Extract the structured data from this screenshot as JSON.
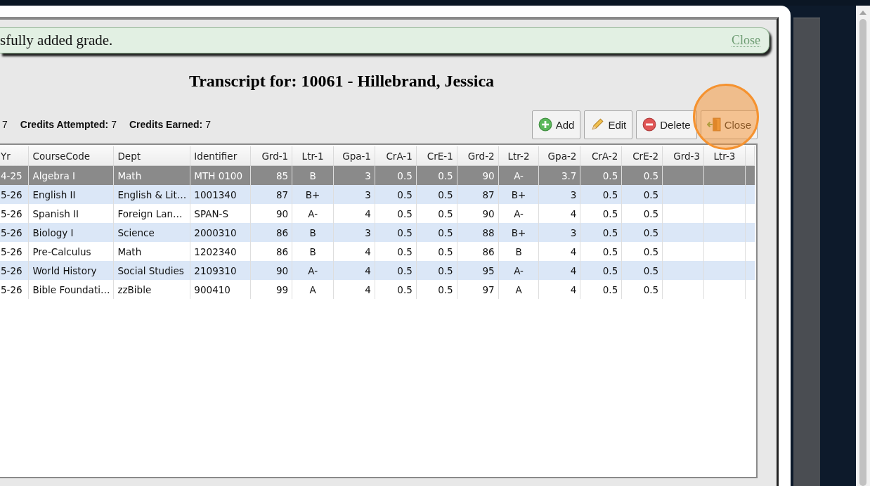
{
  "message": {
    "text": "sfully added grade.",
    "close_label": "Close"
  },
  "title": "Transcript for: 10061 - Hillebrand, Jessica",
  "stats": [
    {
      "value": "7"
    },
    {
      "label": "Credits Attempted:",
      "value": "7"
    },
    {
      "label": "Credits Earned:",
      "value": "7"
    }
  ],
  "buttons": [
    {
      "label": "Add",
      "kind": "add",
      "highlighted": false
    },
    {
      "label": "Edit",
      "kind": "edit",
      "highlighted": false
    },
    {
      "label": "Delete",
      "kind": "delete",
      "highlighted": false
    },
    {
      "label": "Close",
      "kind": "close",
      "highlighted": true
    }
  ],
  "table": {
    "columns": [
      {
        "label": "Yr",
        "kind": "text"
      },
      {
        "label": "CourseCode",
        "kind": "text"
      },
      {
        "label": "Dept",
        "kind": "text"
      },
      {
        "label": "Identifier",
        "kind": "text"
      },
      {
        "label": "Grd-1",
        "kind": "number"
      },
      {
        "label": "Ltr-1",
        "kind": "letter"
      },
      {
        "label": "Gpa-1",
        "kind": "number"
      },
      {
        "label": "CrA-1",
        "kind": "number"
      },
      {
        "label": "CrE-1",
        "kind": "number"
      },
      {
        "label": "Grd-2",
        "kind": "number"
      },
      {
        "label": "Ltr-2",
        "kind": "letter"
      },
      {
        "label": "Gpa-2",
        "kind": "number"
      },
      {
        "label": "CrA-2",
        "kind": "number"
      },
      {
        "label": "CrE-2",
        "kind": "number"
      },
      {
        "label": "Grd-3",
        "kind": "number"
      },
      {
        "label": "Ltr-3",
        "kind": "letter"
      }
    ],
    "rows": [
      {
        "selected": true,
        "cells": [
          "4-25",
          "Algebra I",
          "Math",
          "MTH 0100",
          "85",
          "B",
          "3",
          "0.5",
          "0.5",
          "90",
          "A-",
          "3.7",
          "0.5",
          "0.5"
        ]
      },
      {
        "selected": false,
        "cells": [
          "5-26",
          "English II",
          "English & Lit…",
          "1001340",
          "87",
          "B+",
          "3",
          "0.5",
          "0.5",
          "87",
          "B+",
          "3",
          "0.5",
          "0.5"
        ]
      },
      {
        "selected": false,
        "cells": [
          "5-26",
          "Spanish II",
          "Foreign Lan…",
          "SPAN-S",
          "90",
          "A-",
          "4",
          "0.5",
          "0.5",
          "90",
          "A-",
          "4",
          "0.5",
          "0.5"
        ]
      },
      {
        "selected": false,
        "cells": [
          "5-26",
          "Biology I",
          "Science",
          "2000310",
          "86",
          "B",
          "3",
          "0.5",
          "0.5",
          "88",
          "B+",
          "3",
          "0.5",
          "0.5"
        ]
      },
      {
        "selected": false,
        "cells": [
          "5-26",
          "Pre-Calculus",
          "Math",
          "1202340",
          "86",
          "B",
          "4",
          "0.5",
          "0.5",
          "86",
          "B",
          "4",
          "0.5",
          "0.5"
        ]
      },
      {
        "selected": false,
        "cells": [
          "5-26",
          "World History",
          "Social Studies",
          "2109310",
          "90",
          "A-",
          "4",
          "0.5",
          "0.5",
          "95",
          "A-",
          "4",
          "0.5",
          "0.5"
        ]
      },
      {
        "selected": false,
        "cells": [
          "5-26",
          "Bible Foundati…",
          "zzBible",
          "900410",
          "99",
          "A",
          "4",
          "0.5",
          "0.5",
          "97",
          "A",
          "4",
          "0.5",
          "0.5"
        ]
      }
    ]
  }
}
